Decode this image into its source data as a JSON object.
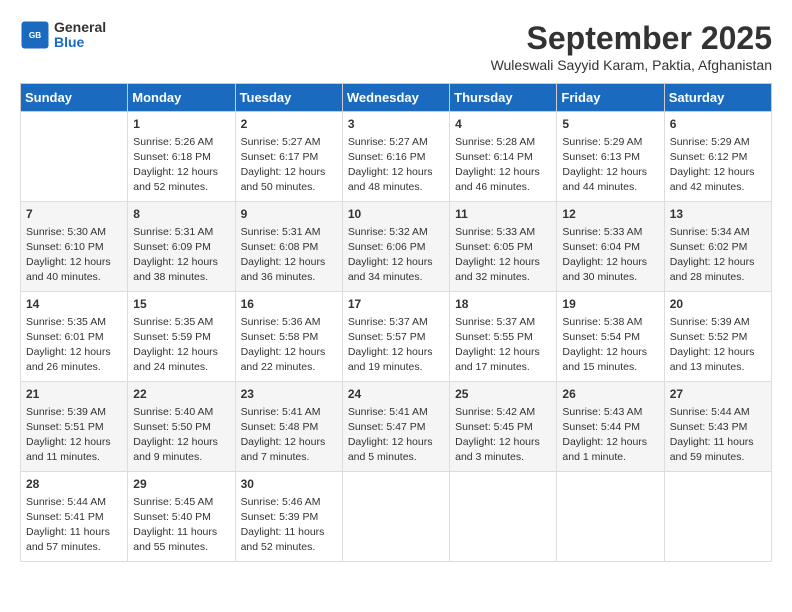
{
  "logo": {
    "general": "General",
    "blue": "Blue"
  },
  "header": {
    "title": "September 2025",
    "subtitle": "Wuleswali Sayyid Karam, Paktia, Afghanistan"
  },
  "weekdays": [
    "Sunday",
    "Monday",
    "Tuesday",
    "Wednesday",
    "Thursday",
    "Friday",
    "Saturday"
  ],
  "weeks": [
    [
      {
        "day": "",
        "content": ""
      },
      {
        "day": "1",
        "content": "Sunrise: 5:26 AM\nSunset: 6:18 PM\nDaylight: 12 hours\nand 52 minutes."
      },
      {
        "day": "2",
        "content": "Sunrise: 5:27 AM\nSunset: 6:17 PM\nDaylight: 12 hours\nand 50 minutes."
      },
      {
        "day": "3",
        "content": "Sunrise: 5:27 AM\nSunset: 6:16 PM\nDaylight: 12 hours\nand 48 minutes."
      },
      {
        "day": "4",
        "content": "Sunrise: 5:28 AM\nSunset: 6:14 PM\nDaylight: 12 hours\nand 46 minutes."
      },
      {
        "day": "5",
        "content": "Sunrise: 5:29 AM\nSunset: 6:13 PM\nDaylight: 12 hours\nand 44 minutes."
      },
      {
        "day": "6",
        "content": "Sunrise: 5:29 AM\nSunset: 6:12 PM\nDaylight: 12 hours\nand 42 minutes."
      }
    ],
    [
      {
        "day": "7",
        "content": "Sunrise: 5:30 AM\nSunset: 6:10 PM\nDaylight: 12 hours\nand 40 minutes."
      },
      {
        "day": "8",
        "content": "Sunrise: 5:31 AM\nSunset: 6:09 PM\nDaylight: 12 hours\nand 38 minutes."
      },
      {
        "day": "9",
        "content": "Sunrise: 5:31 AM\nSunset: 6:08 PM\nDaylight: 12 hours\nand 36 minutes."
      },
      {
        "day": "10",
        "content": "Sunrise: 5:32 AM\nSunset: 6:06 PM\nDaylight: 12 hours\nand 34 minutes."
      },
      {
        "day": "11",
        "content": "Sunrise: 5:33 AM\nSunset: 6:05 PM\nDaylight: 12 hours\nand 32 minutes."
      },
      {
        "day": "12",
        "content": "Sunrise: 5:33 AM\nSunset: 6:04 PM\nDaylight: 12 hours\nand 30 minutes."
      },
      {
        "day": "13",
        "content": "Sunrise: 5:34 AM\nSunset: 6:02 PM\nDaylight: 12 hours\nand 28 minutes."
      }
    ],
    [
      {
        "day": "14",
        "content": "Sunrise: 5:35 AM\nSunset: 6:01 PM\nDaylight: 12 hours\nand 26 minutes."
      },
      {
        "day": "15",
        "content": "Sunrise: 5:35 AM\nSunset: 5:59 PM\nDaylight: 12 hours\nand 24 minutes."
      },
      {
        "day": "16",
        "content": "Sunrise: 5:36 AM\nSunset: 5:58 PM\nDaylight: 12 hours\nand 22 minutes."
      },
      {
        "day": "17",
        "content": "Sunrise: 5:37 AM\nSunset: 5:57 PM\nDaylight: 12 hours\nand 19 minutes."
      },
      {
        "day": "18",
        "content": "Sunrise: 5:37 AM\nSunset: 5:55 PM\nDaylight: 12 hours\nand 17 minutes."
      },
      {
        "day": "19",
        "content": "Sunrise: 5:38 AM\nSunset: 5:54 PM\nDaylight: 12 hours\nand 15 minutes."
      },
      {
        "day": "20",
        "content": "Sunrise: 5:39 AM\nSunset: 5:52 PM\nDaylight: 12 hours\nand 13 minutes."
      }
    ],
    [
      {
        "day": "21",
        "content": "Sunrise: 5:39 AM\nSunset: 5:51 PM\nDaylight: 12 hours\nand 11 minutes."
      },
      {
        "day": "22",
        "content": "Sunrise: 5:40 AM\nSunset: 5:50 PM\nDaylight: 12 hours\nand 9 minutes."
      },
      {
        "day": "23",
        "content": "Sunrise: 5:41 AM\nSunset: 5:48 PM\nDaylight: 12 hours\nand 7 minutes."
      },
      {
        "day": "24",
        "content": "Sunrise: 5:41 AM\nSunset: 5:47 PM\nDaylight: 12 hours\nand 5 minutes."
      },
      {
        "day": "25",
        "content": "Sunrise: 5:42 AM\nSunset: 5:45 PM\nDaylight: 12 hours\nand 3 minutes."
      },
      {
        "day": "26",
        "content": "Sunrise: 5:43 AM\nSunset: 5:44 PM\nDaylight: 12 hours\nand 1 minute."
      },
      {
        "day": "27",
        "content": "Sunrise: 5:44 AM\nSunset: 5:43 PM\nDaylight: 11 hours\nand 59 minutes."
      }
    ],
    [
      {
        "day": "28",
        "content": "Sunrise: 5:44 AM\nSunset: 5:41 PM\nDaylight: 11 hours\nand 57 minutes."
      },
      {
        "day": "29",
        "content": "Sunrise: 5:45 AM\nSunset: 5:40 PM\nDaylight: 11 hours\nand 55 minutes."
      },
      {
        "day": "30",
        "content": "Sunrise: 5:46 AM\nSunset: 5:39 PM\nDaylight: 11 hours\nand 52 minutes."
      },
      {
        "day": "",
        "content": ""
      },
      {
        "day": "",
        "content": ""
      },
      {
        "day": "",
        "content": ""
      },
      {
        "day": "",
        "content": ""
      }
    ]
  ]
}
